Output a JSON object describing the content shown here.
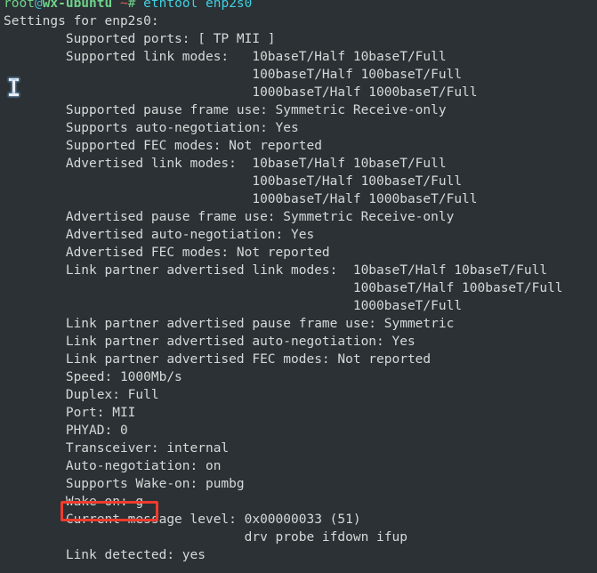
{
  "terminal": {
    "background_color": "#2b3134",
    "foreground_color": "#d6d9da",
    "prompt": {
      "user": "root",
      "at": "@",
      "host": "wx-ubuntu",
      "path": "~",
      "symbol": "#",
      "command": "ethtool enp2s0"
    },
    "output_lines": [
      "Settings for enp2s0:",
      "        Supported ports: [ TP MII ]",
      "        Supported link modes:   10baseT/Half 10baseT/Full",
      "                                100baseT/Half 100baseT/Full",
      "                                1000baseT/Half 1000baseT/Full",
      "        Supported pause frame use: Symmetric Receive-only",
      "        Supports auto-negotiation: Yes",
      "        Supported FEC modes: Not reported",
      "        Advertised link modes:  10baseT/Half 10baseT/Full",
      "                                100baseT/Half 100baseT/Full",
      "                                1000baseT/Half 1000baseT/Full",
      "        Advertised pause frame use: Symmetric Receive-only",
      "        Advertised auto-negotiation: Yes",
      "        Advertised FEC modes: Not reported",
      "        Link partner advertised link modes:  10baseT/Half 10baseT/Full",
      "                                             100baseT/Half 100baseT/Full",
      "                                             1000baseT/Full",
      "        Link partner advertised pause frame use: Symmetric",
      "        Link partner advertised auto-negotiation: Yes",
      "        Link partner advertised FEC modes: Not reported",
      "        Speed: 1000Mb/s",
      "        Duplex: Full",
      "        Port: MII",
      "        PHYAD: 0",
      "        Transceiver: internal",
      "        Auto-negotiation: on",
      "        Supports Wake-on: pumbg",
      "        Wake-on: g",
      "        Current message level: 0x00000033 (51)",
      "                               drv probe ifdown ifup",
      "        Link detected: yes"
    ]
  },
  "annotations": {
    "wake_on_highlight": {
      "color": "#ef3b2d",
      "target_text": "Wake-on: g"
    }
  },
  "cursor": {
    "type": "i-beam"
  }
}
